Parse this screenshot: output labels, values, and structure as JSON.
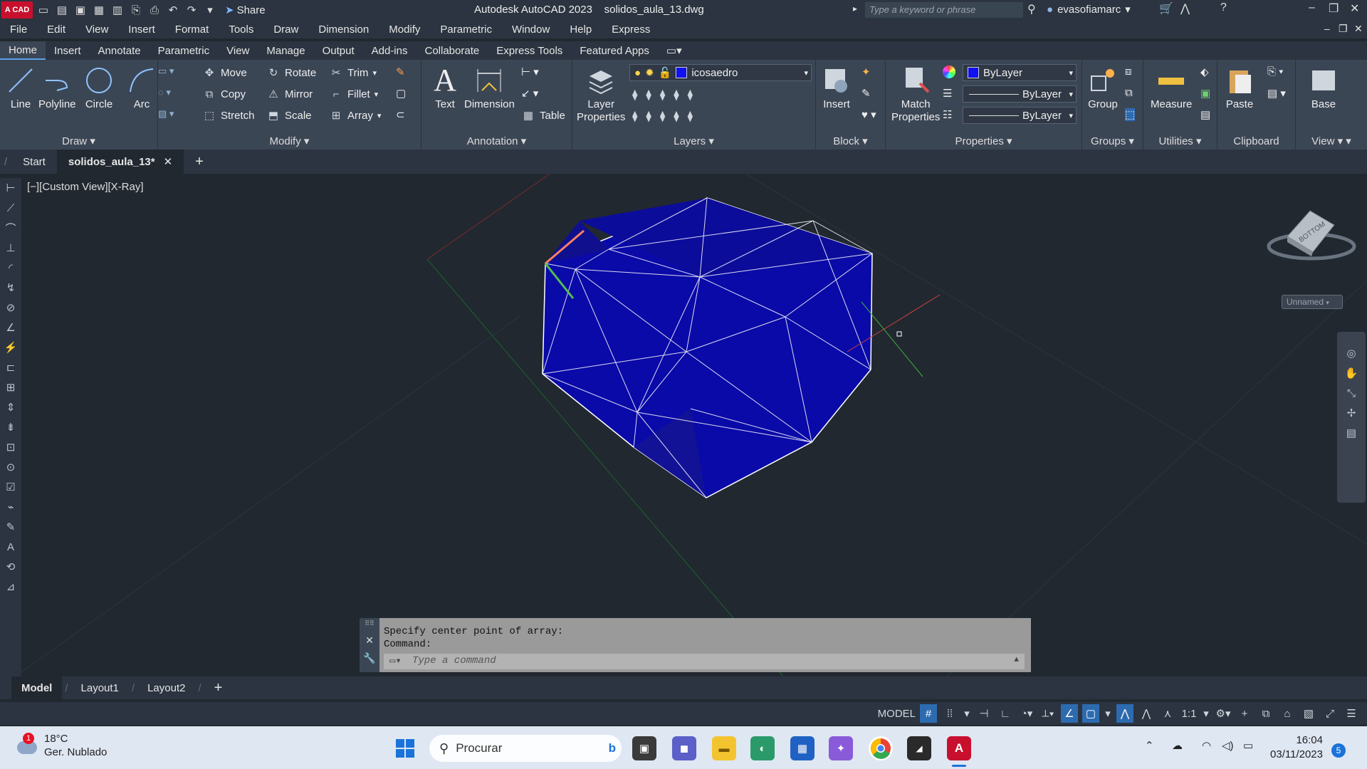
{
  "titlebar": {
    "logo": "A CAD",
    "share_label": "Share",
    "title": "Autodesk AutoCAD 2023    solidos_aula_13.dwg",
    "search_placeholder": "Type a keyword or phrase",
    "username": "evasofiamarc"
  },
  "menu": [
    "File",
    "Edit",
    "View",
    "Insert",
    "Format",
    "Tools",
    "Draw",
    "Dimension",
    "Modify",
    "Parametric",
    "Window",
    "Help",
    "Express"
  ],
  "ribbon_tabs": [
    "Home",
    "Insert",
    "Annotate",
    "Parametric",
    "View",
    "Manage",
    "Output",
    "Add-ins",
    "Collaborate",
    "Express Tools",
    "Featured Apps"
  ],
  "ribbon": {
    "draw": {
      "title": "Draw",
      "line": "Line",
      "polyline": "Polyline",
      "circle": "Circle",
      "arc": "Arc"
    },
    "modify": {
      "title": "Modify",
      "move": "Move",
      "rotate": "Rotate",
      "trim": "Trim",
      "copy": "Copy",
      "mirror": "Mirror",
      "fillet": "Fillet",
      "stretch": "Stretch",
      "scale": "Scale",
      "array": "Array"
    },
    "annotation": {
      "title": "Annotation",
      "text": "Text",
      "dimension": "Dimension",
      "table": "Table"
    },
    "layers": {
      "title": "Layers",
      "layer_properties_1": "Layer",
      "layer_properties_2": "Properties",
      "current_layer": "icosaedro"
    },
    "block": {
      "title": "Block",
      "insert": "Insert"
    },
    "properties": {
      "title": "Properties",
      "match_1": "Match",
      "match_2": "Properties",
      "color": "ByLayer",
      "lineweight": "ByLayer",
      "linetype": "ByLayer"
    },
    "groups": {
      "title": "Groups",
      "group": "Group"
    },
    "utilities": {
      "title": "Utilities",
      "measure": "Measure"
    },
    "clipboard": {
      "title": "Clipboard",
      "paste": "Paste"
    },
    "view": {
      "title": "View",
      "base": "Base"
    }
  },
  "file_tabs": {
    "start": "Start",
    "current": "solidos_aula_13*"
  },
  "viewport": {
    "label": "[−][Custom View][X-Ray]",
    "viewcube_face": "BOTTOM",
    "ucs_name": "Unnamed"
  },
  "command": {
    "line1": "Specify center point of array:",
    "line2": "Command:",
    "placeholder": "Type a command"
  },
  "layout_tabs": [
    "Model",
    "Layout1",
    "Layout2"
  ],
  "status": {
    "model": "MODEL",
    "scale": "1:1"
  },
  "taskbar": {
    "weather_temp": "18°C",
    "weather_desc": "Ger. Nublado",
    "weather_badge": "1",
    "search": "Procurar",
    "time": "16:04",
    "date": "03/11/2023",
    "notif_count": "5"
  },
  "colors": {
    "accent": "#2d6bb0",
    "solid_fill": "#0a0aa8",
    "layer_swatch": "#1010f0",
    "autocad_red": "#c8102e"
  }
}
